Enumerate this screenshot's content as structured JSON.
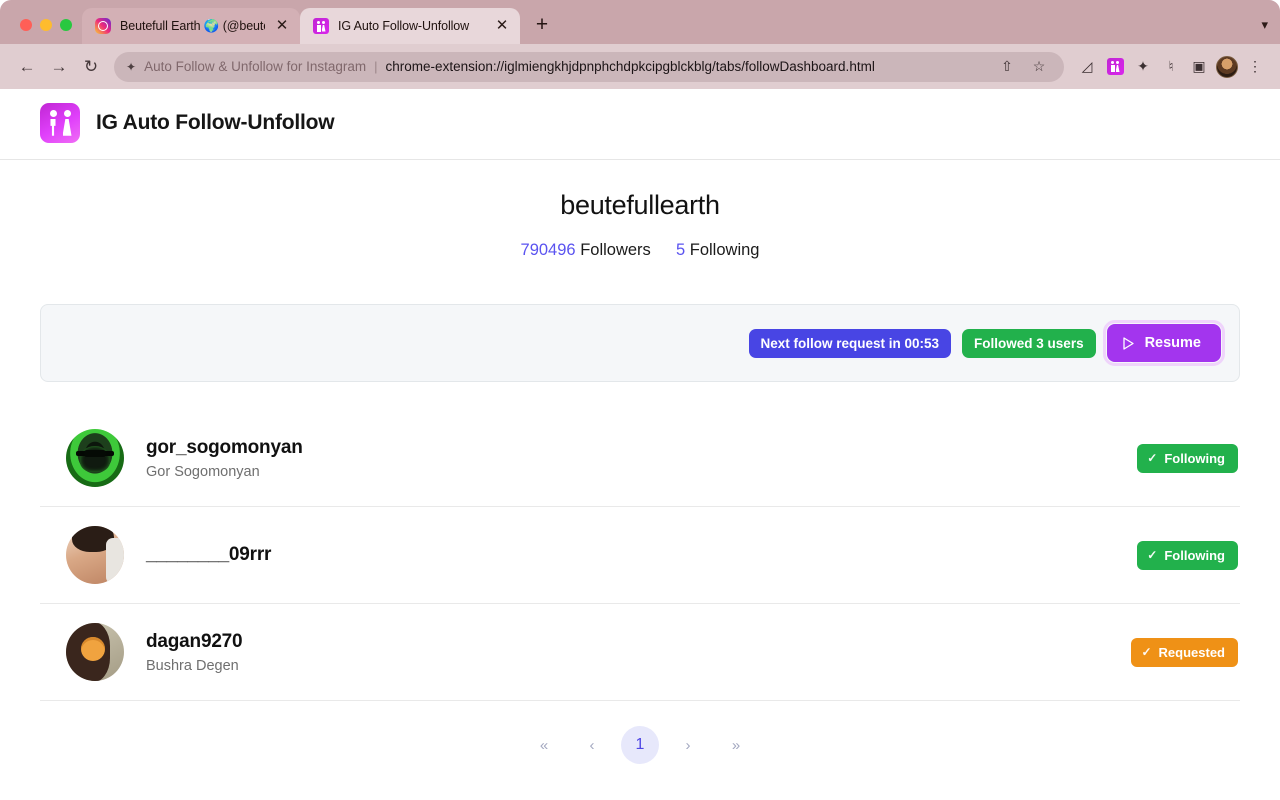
{
  "browser": {
    "window_controls": [
      "close",
      "minimize",
      "maximize"
    ],
    "tabs": [
      {
        "title": "Beutefull Earth 🌍 (@beutefull",
        "favicon": "instagram-icon",
        "active": false,
        "close_label": "✕"
      },
      {
        "title": "IG Auto Follow-Unfollow",
        "favicon": "extension-people-icon",
        "active": true,
        "close_label": "✕"
      }
    ],
    "new_tab_label": "+",
    "tab_list_chevron": "▾",
    "nav": {
      "back": "←",
      "forward": "→",
      "reload": "↻"
    },
    "omnibox": {
      "extension_name": "Auto Follow & Unfollow for Instagram",
      "separator": "|",
      "url": "chrome-extension://iglmiengkhjdpnphchdpkcipgblckblg/tabs/followDashboard.html",
      "share_icon": "share-icon",
      "bookmark_icon": "star-icon"
    },
    "toolbar_icons": [
      {
        "name": "fullscreen-icon",
        "glyph": "⤢"
      },
      {
        "name": "ig-auto-follow-extension-icon",
        "glyph": ""
      },
      {
        "name": "extensions-puzzle-icon",
        "glyph": "✦"
      },
      {
        "name": "reading-list-icon",
        "glyph": "♫"
      },
      {
        "name": "side-panel-icon",
        "glyph": "■"
      },
      {
        "name": "profile-avatar",
        "glyph": ""
      },
      {
        "name": "chrome-menu-icon",
        "glyph": "⋮"
      }
    ]
  },
  "app": {
    "logo_name": "ig-auto-follow-unfollow-logo",
    "title": "IG Auto Follow-Unfollow"
  },
  "profile": {
    "username": "beutefullearth",
    "followers_count": "790496",
    "followers_label": "Followers",
    "following_count": "5",
    "following_label": "Following"
  },
  "status_bar": {
    "timer_badge": "Next follow request in 00:53",
    "followed_badge": "Followed 3 users",
    "resume_button": "Resume",
    "resume_icon": "play-icon"
  },
  "users": [
    {
      "handle": "gor_sogomonyan",
      "fullname": "Gor Sogomonyan",
      "avatar": "green-skull-avatar",
      "status": "Following",
      "status_type": "following",
      "status_icon": "check-icon"
    },
    {
      "handle": "________09rrr",
      "fullname": "",
      "avatar": "young-man-avatar",
      "status": "Following",
      "status_type": "following",
      "status_icon": "check-icon"
    },
    {
      "handle": "dagan9270",
      "fullname": "Bushra Degen",
      "avatar": "hijab-woman-avatar",
      "status": "Requested",
      "status_type": "requested",
      "status_icon": "check-icon"
    }
  ],
  "pagination": {
    "first": "«",
    "prev": "‹",
    "current_page": "1",
    "next": "›",
    "last": "»"
  },
  "colors": {
    "accent_purple": "#a335ee",
    "link_blue": "#5a53f0",
    "badge_blue": "#4845e4",
    "badge_green": "#22b14c",
    "badge_orange": "#ef9116"
  }
}
